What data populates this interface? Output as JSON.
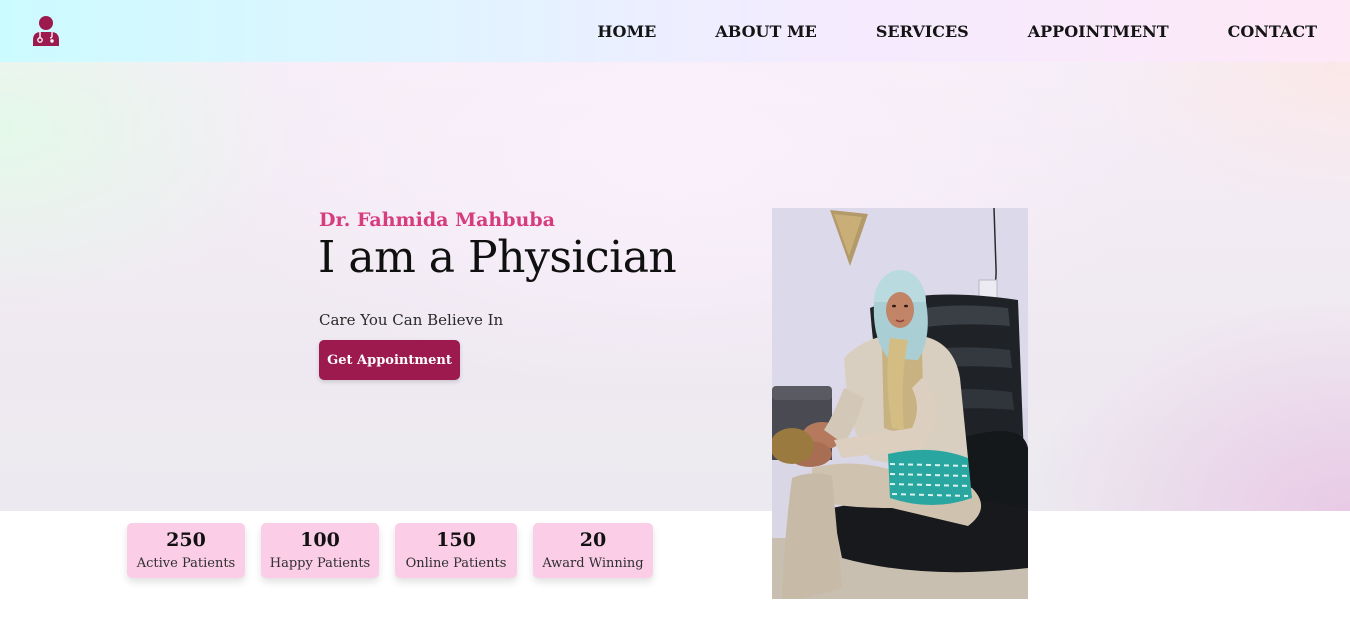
{
  "nav": {
    "logo_icon": "doctor-icon",
    "links": [
      "HOME",
      "ABOUT ME",
      "SERVICES",
      "APPOINTMENT",
      "CONTACT"
    ]
  },
  "hero": {
    "name": "Dr. Fahmida Mahbuba",
    "headline": "I am a Physician",
    "tagline": "Care You Can Believe In",
    "cta_label": "Get Appointment"
  },
  "stats": [
    {
      "value": "250",
      "label": "Active Patients"
    },
    {
      "value": "100",
      "label": "Happy Patients"
    },
    {
      "value": "150",
      "label": "Online Patients"
    },
    {
      "value": "20",
      "label": "Award Winning"
    }
  ],
  "colors": {
    "brand": "#9c1a4e",
    "name_accent": "#d63c7e",
    "stat_bg": "#fbcde7"
  }
}
